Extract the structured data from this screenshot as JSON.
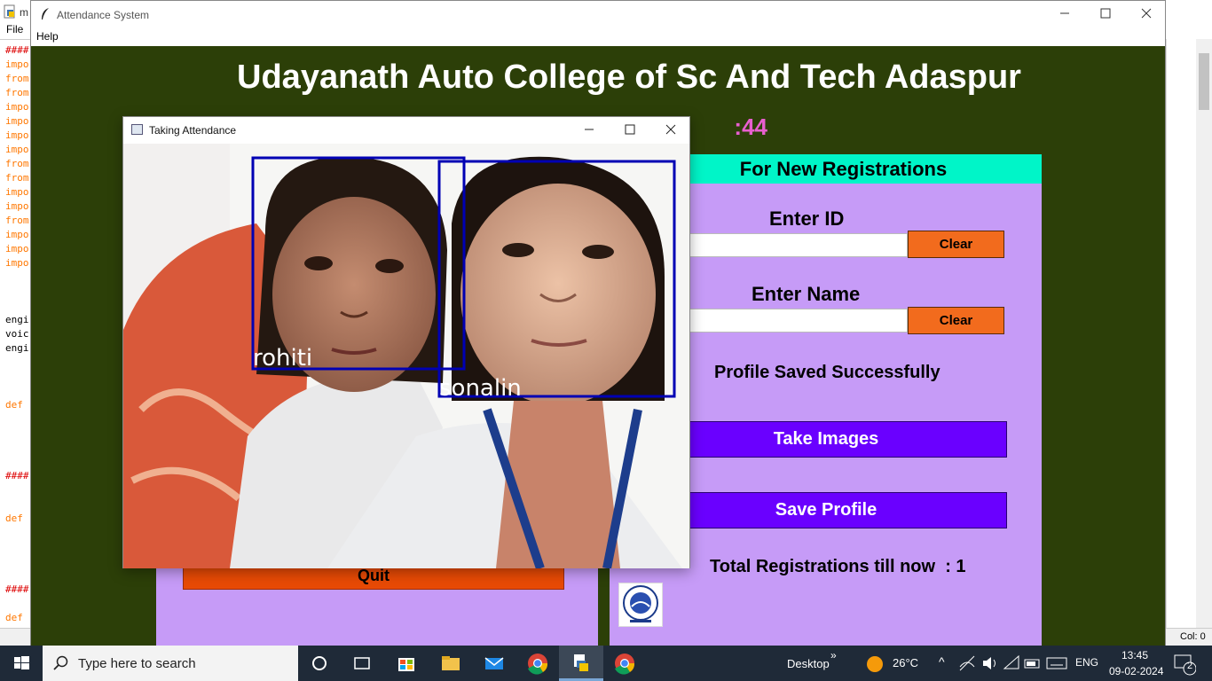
{
  "editor": {
    "title_fragment": "m",
    "menu_file": "File",
    "code_lines": [
      {
        "text": "####",
        "color": "#dd0000"
      },
      {
        "text": "impo",
        "color": "#ff7700"
      },
      {
        "text": "from",
        "color": "#ff7700"
      },
      {
        "text": "from",
        "color": "#ff7700"
      },
      {
        "text": "impo",
        "color": "#ff7700"
      },
      {
        "text": "impo",
        "color": "#ff7700"
      },
      {
        "text": "impo",
        "color": "#ff7700"
      },
      {
        "text": "impo",
        "color": "#ff7700"
      },
      {
        "text": "from",
        "color": "#ff7700"
      },
      {
        "text": "from",
        "color": "#ff7700"
      },
      {
        "text": "impo",
        "color": "#ff7700"
      },
      {
        "text": "impo",
        "color": "#ff7700"
      },
      {
        "text": "from",
        "color": "#ff7700"
      },
      {
        "text": "impo",
        "color": "#ff7700"
      },
      {
        "text": "impo",
        "color": "#ff7700"
      },
      {
        "text": "impo",
        "color": "#ff7700"
      },
      {
        "text": "engi",
        "color": "#000000"
      },
      {
        "text": "voic",
        "color": "#000000"
      },
      {
        "text": "engi",
        "color": "#000000"
      },
      {
        "text": "def",
        "color": "#ff7700"
      },
      {
        "text": "####",
        "color": "#dd0000"
      },
      {
        "text": "def",
        "color": "#ff7700"
      },
      {
        "text": "####",
        "color": "#dd0000"
      },
      {
        "text": "def",
        "color": "#ff7700"
      }
    ],
    "status_col": "Col: 0"
  },
  "app": {
    "window_title": "Attendance System",
    "menu_help": "Help",
    "college_name": "Udayanath Auto College of Sc And Tech Adaspur",
    "clock_visible": ":44",
    "quit_label": "Quit",
    "registration": {
      "header": "For New Registrations",
      "enter_id_label": "Enter ID",
      "id_value": "",
      "clear_label": "Clear",
      "enter_name_label": "Enter Name",
      "name_value": "",
      "status_message": "Profile Saved Successfully",
      "take_images_label": "Take Images",
      "save_profile_label": "Save Profile",
      "total_label": "Total Registrations till now  : 1"
    }
  },
  "camera": {
    "window_title": "Taking Attendance",
    "face1_label": "rohiti",
    "face2_label": "sonalin"
  },
  "taskbar": {
    "search_placeholder": "Type here to search",
    "desktop_label": "Desktop",
    "weather": "26°C",
    "language": "ENG",
    "time": "13:45",
    "date": "09-02-2024",
    "notification_count": "2"
  },
  "colors": {
    "app_bg": "#2c3f08",
    "panel": "#c69bf7",
    "header": "#00f5c8",
    "clear_button": "#f26b1d",
    "action_button": "#6a00ff",
    "quit_button": "#e84a05",
    "clock": "#e85fcf",
    "face_box": "#0000b4"
  }
}
